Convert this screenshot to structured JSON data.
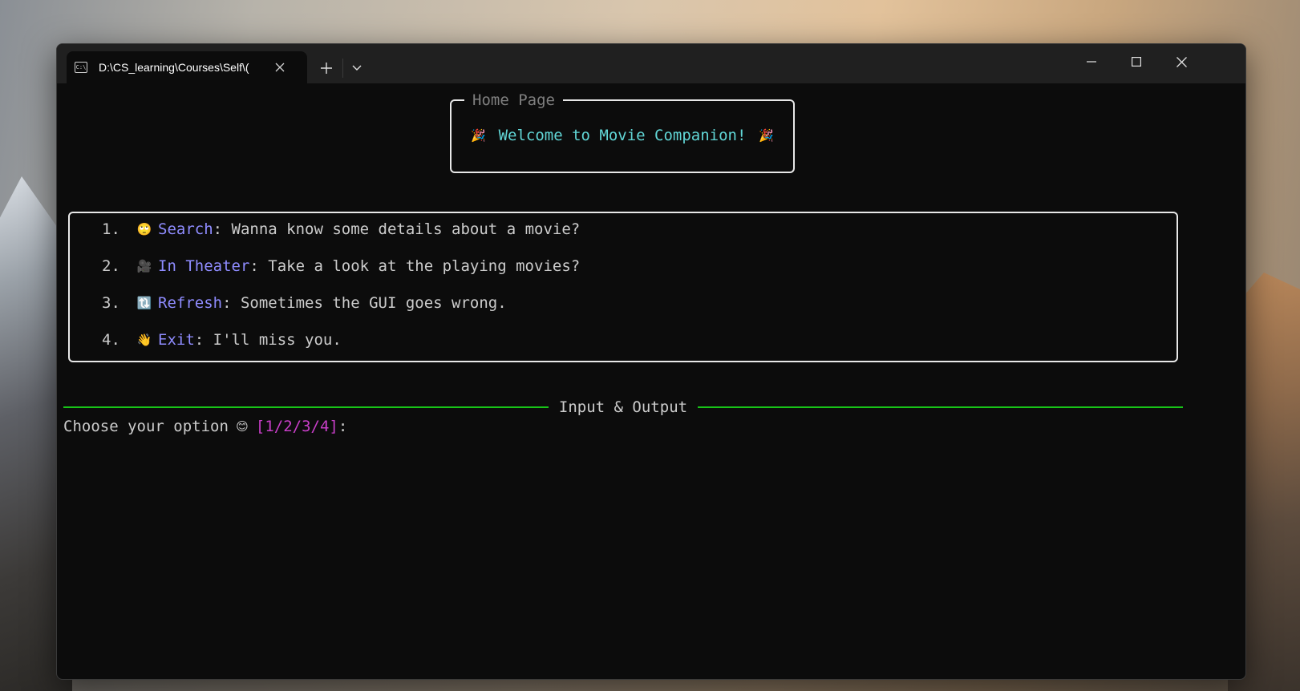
{
  "window": {
    "tab_title": "D:\\CS_learning\\Courses\\Self\\(",
    "tab_icon": "terminal-icon",
    "tab_icon_text": "C:\\"
  },
  "home_panel": {
    "title": "Home Page",
    "welcome": "Welcome to Movie Companion!",
    "left_emoji": "🎉",
    "right_emoji": "🎉"
  },
  "menu": {
    "items": [
      {
        "number": "1.",
        "emoji": "🙄",
        "label": "Search",
        "description": ": Wanna know some details about a movie?"
      },
      {
        "number": "2.",
        "emoji": "🎥",
        "label": "In Theater",
        "description": ": Take a look at the playing movies?"
      },
      {
        "number": "3.",
        "emoji": "🔃",
        "label": "Refresh",
        "description": ": Sometimes the GUI goes wrong."
      },
      {
        "number": "4.",
        "emoji": "👋",
        "label": "Exit",
        "description": ": I'll miss you."
      }
    ]
  },
  "io": {
    "title": "Input & Output",
    "prompt_text": "Choose your option",
    "prompt_emoji": "😊",
    "prompt_choices": "[1/2/3/4]",
    "prompt_suffix": ":"
  },
  "colors": {
    "terminal_bg": "#0c0c0c",
    "titlebar_bg": "#202020",
    "text": "#cccccc",
    "welcome": "#61d6d6",
    "menu_label": "#8f8cff",
    "rule": "#18c418",
    "choices": "#c83ec8",
    "panel_title": "#7f7f7f"
  }
}
